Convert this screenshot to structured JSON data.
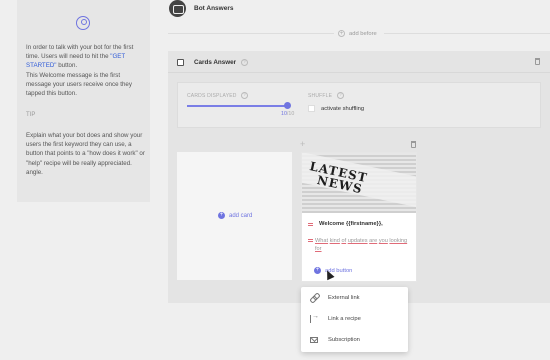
{
  "left_panel": {
    "intro_before": "In order to talk with your bot for the first time. Users will need to hit the ",
    "intro_button_name": "\"GET STARTED\"",
    "intro_after": " button.",
    "welcome_text": "This Welcome message is the first message your users receive once they tapped this button.",
    "tip_label": "TIP",
    "tip_text": "Explain what your bot does and show your users the first keyword they can use, a button that points to a \"how does it work\" or \"help\" recipe will be really appreciated. angle."
  },
  "header": {
    "title": "Bot Answers",
    "add_before": "add before"
  },
  "cards_answer": {
    "title": "Cards Answer",
    "cards_displayed_label": "CARDS DISPLAYED",
    "cards_displayed_value": "10",
    "cards_displayed_max": "/10",
    "shuffle_label": "SHUFFLE",
    "shuffle_option": "activate shuffling",
    "add_card": "add card"
  },
  "card": {
    "image_headline_1": "LATEST",
    "image_headline_2": "NEWS",
    "title": "Welcome {{firstname}},",
    "subtitle_words": [
      "What",
      "kind",
      "of",
      "updates",
      "are",
      "you",
      "looking",
      "for"
    ],
    "add_button": "add button"
  },
  "dropdown": {
    "items": [
      "External link",
      "Link a recipe",
      "Subscription"
    ]
  },
  "colors": {
    "accent": "#6f74e0",
    "handle": "#e06b78"
  }
}
